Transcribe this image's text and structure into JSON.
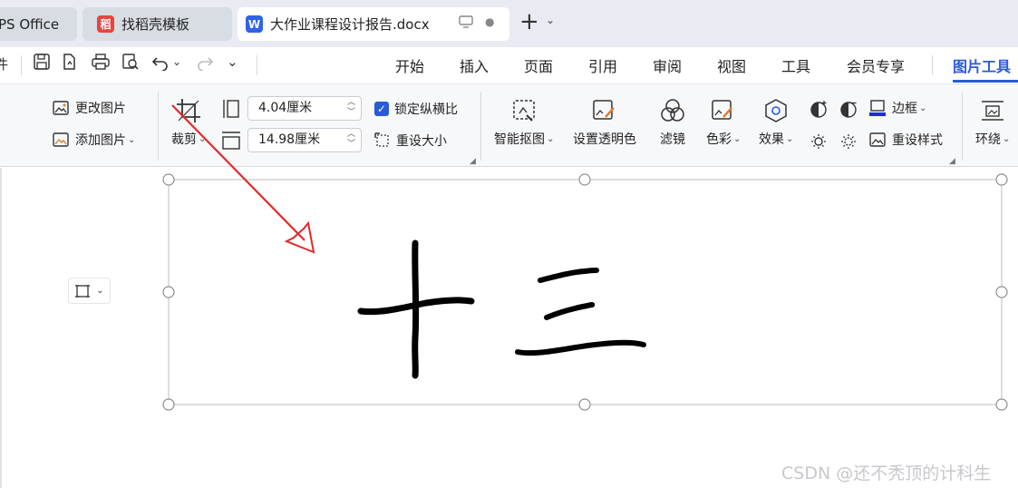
{
  "tabs": [
    {
      "label": "PS Office"
    },
    {
      "label": "找稻壳模板"
    },
    {
      "label": "大作业课程设计报告.docx"
    }
  ],
  "tab_icons": {
    "wps": "W",
    "daoke": "稻",
    "doc": "W"
  },
  "tab_controls": {
    "screen": "screen-icon",
    "dot": "●",
    "new_tab": "+",
    "new_tab_drop": "⌄"
  },
  "quick_access": {
    "partial": "件",
    "undo_caret": "⌄",
    "more": "⌄"
  },
  "menu": {
    "items": [
      "开始",
      "插入",
      "页面",
      "引用",
      "审阅",
      "视图",
      "工具",
      "会员专享",
      "图片工具"
    ],
    "active_index": 8
  },
  "ribbon": {
    "change_picture": "更改图片",
    "add_picture": "添加图片",
    "crop": "裁剪",
    "width_value": "4.04厘米",
    "height_value": "14.98厘米",
    "lock_ratio": "锁定纵横比",
    "reset_size": "重设大小",
    "smart_cutout": "智能抠图",
    "set_transparent": "设置透明色",
    "filter": "滤镜",
    "color": "色彩",
    "effect": "效果",
    "border": "边框",
    "reset_style": "重设样式",
    "wrap": "环绕",
    "check_mark": "✓",
    "spin_up": "︿",
    "spin_down": "﹀",
    "caret": "⌄",
    "launcher": "◢"
  },
  "watermark": "CSDN @还不秃顶的计科生",
  "colors": {
    "accent": "#2a5ad8",
    "arrow": "#e02a2a",
    "border_bar": "#1a2fd6"
  }
}
